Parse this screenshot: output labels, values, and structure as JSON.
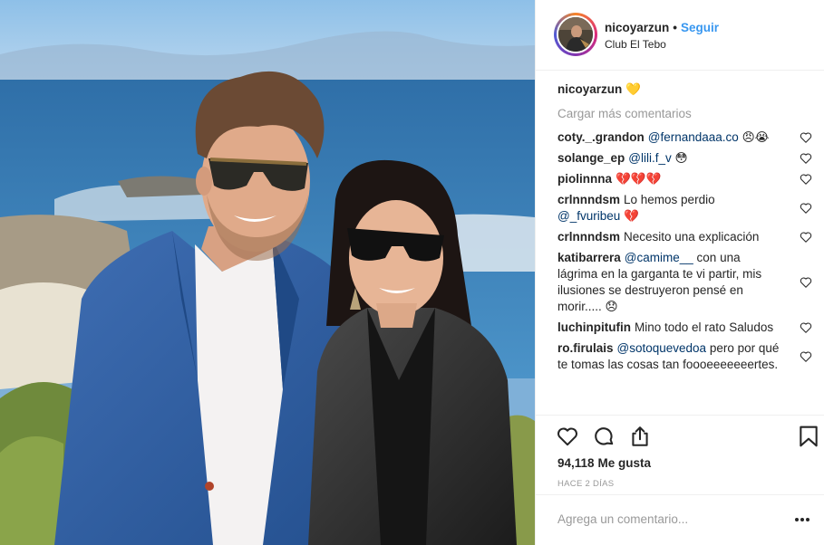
{
  "header": {
    "username": "nicoyarzun",
    "separator": "•",
    "follow_label": "Seguir",
    "location": "Club El Tebo"
  },
  "caption": {
    "user": "nicoyarzun",
    "emoji": "💛"
  },
  "load_more": "Cargar más comentarios",
  "comments": [
    {
      "user": "coty._.grandon",
      "mention": "@fernandaaa.co",
      "text": "",
      "emoji": "😠😭"
    },
    {
      "user": "solange_ep",
      "mention": "@lili.f_v",
      "text": "",
      "emoji": "😳"
    },
    {
      "user": "piolinnna",
      "mention": "",
      "text": "",
      "emoji": "💔💔💔"
    },
    {
      "user": "crlnnndsm",
      "mention": "",
      "text": "Lo hemos perdio",
      "mention2": "@_fvuribeu",
      "emoji": "💔"
    },
    {
      "user": "crlnnndsm",
      "mention": "",
      "text": "Necesito una explicación",
      "emoji": ""
    },
    {
      "user": "katibarrera",
      "mention": "@camime__",
      "text": "con una lágrima en la garganta te vi partir, mis ilusiones se destruyeron pensé en morir.....",
      "emoji": "😞"
    },
    {
      "user": "luchinpitufin",
      "mention": "",
      "text": "Mino todo el rato Saludos",
      "emoji": ""
    },
    {
      "user": "ro.firulais",
      "mention": "@sotoquevedoa",
      "text": "pero por qué te tomas las cosas tan foooeeeeeeertes.",
      "emoji": ""
    }
  ],
  "likes": {
    "count": "94,118",
    "label": "Me gusta"
  },
  "time_ago": "HACE 2 DÍAS",
  "add_comment": {
    "placeholder": "Agrega un comentario..."
  },
  "icons": {
    "like": "heart-outline-icon",
    "comment": "speech-bubble-icon",
    "share": "share-upload-icon",
    "save": "bookmark-icon",
    "more": "ellipsis-icon",
    "comment_like": "small-heart-icon"
  },
  "colors": {
    "link": "#3897f0",
    "mention": "#003569",
    "muted": "#999999",
    "border": "#efefef"
  }
}
